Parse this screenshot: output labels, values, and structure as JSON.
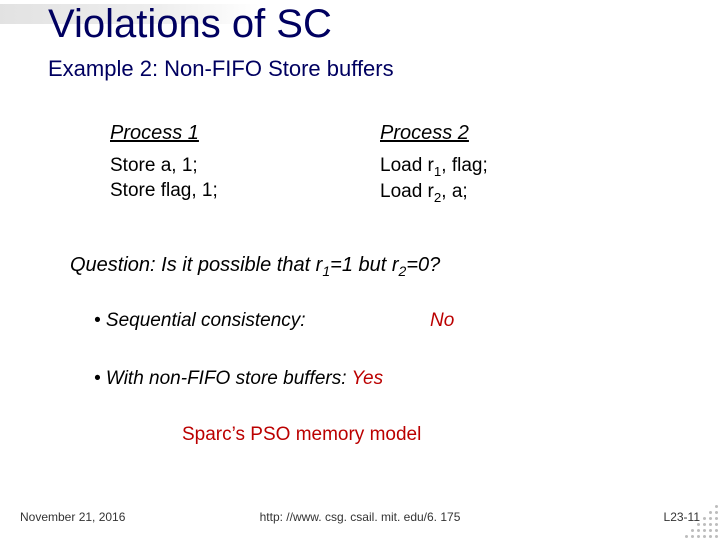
{
  "title": "Violations of SC",
  "subtitle": "Example 2: Non-FIFO Store buffers",
  "process1": {
    "label": "Process 1",
    "line1": "Store a, 1;",
    "line2": "Store flag, 1;"
  },
  "process2": {
    "label": "Process 2",
    "line1_pre": "Load r",
    "line1_sub": "1",
    "line1_post": ", flag;",
    "line2_pre": "Load r",
    "line2_sub": "2",
    "line2_post": ", a;"
  },
  "question": {
    "pre": "Question:  Is it possible that  r",
    "sub1": "1",
    "mid": "=1 but r",
    "sub2": "2",
    "post": "=0?"
  },
  "bullet1": {
    "text": "•  Sequential consistency:",
    "answer": "No"
  },
  "bullet2": {
    "text": "•  With non-FIFO store buffers:  ",
    "answer": "Yes"
  },
  "sparc": "Sparc’s PSO memory model",
  "footer": {
    "date": "November 21, 2016",
    "url": "http: //www. csg. csail. mit. edu/6. 175",
    "page": "L23-11"
  }
}
